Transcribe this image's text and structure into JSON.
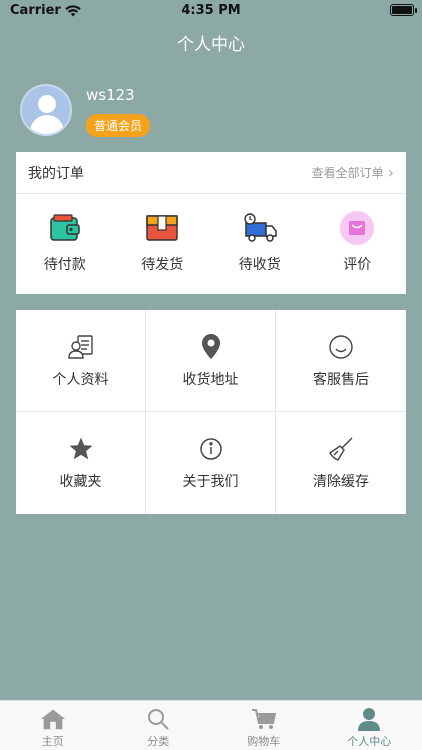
{
  "status_bar": {
    "carrier": "Carrier",
    "time": "4:35 PM"
  },
  "nav": {
    "title": "个人中心"
  },
  "profile": {
    "username": "ws123",
    "badge": "普通会员"
  },
  "orders": {
    "title": "我的订单",
    "view_all": "查看全部订单",
    "items": [
      {
        "label": "待付款",
        "icon": "wallet-icon"
      },
      {
        "label": "待发货",
        "icon": "package-icon"
      },
      {
        "label": "待收货",
        "icon": "delivery-truck-icon"
      },
      {
        "label": "评价",
        "icon": "review-icon"
      }
    ]
  },
  "menu": {
    "items": [
      {
        "label": "个人资料",
        "icon": "profile-card-icon"
      },
      {
        "label": "收货地址",
        "icon": "location-pin-icon"
      },
      {
        "label": "客服售后",
        "icon": "smiley-icon"
      },
      {
        "label": "收藏夹",
        "icon": "star-icon"
      },
      {
        "label": "关于我们",
        "icon": "info-icon"
      },
      {
        "label": "清除缓存",
        "icon": "broom-icon"
      }
    ]
  },
  "tabbar": {
    "tabs": [
      {
        "label": "主页",
        "icon": "home-icon"
      },
      {
        "label": "分类",
        "icon": "search-icon"
      },
      {
        "label": "购物车",
        "icon": "cart-icon"
      },
      {
        "label": "个人中心",
        "icon": "user-icon",
        "active": true
      }
    ]
  },
  "colors": {
    "background": "#8da9a6",
    "badge": "#f5a21c",
    "active_tab": "#5f8c86"
  }
}
